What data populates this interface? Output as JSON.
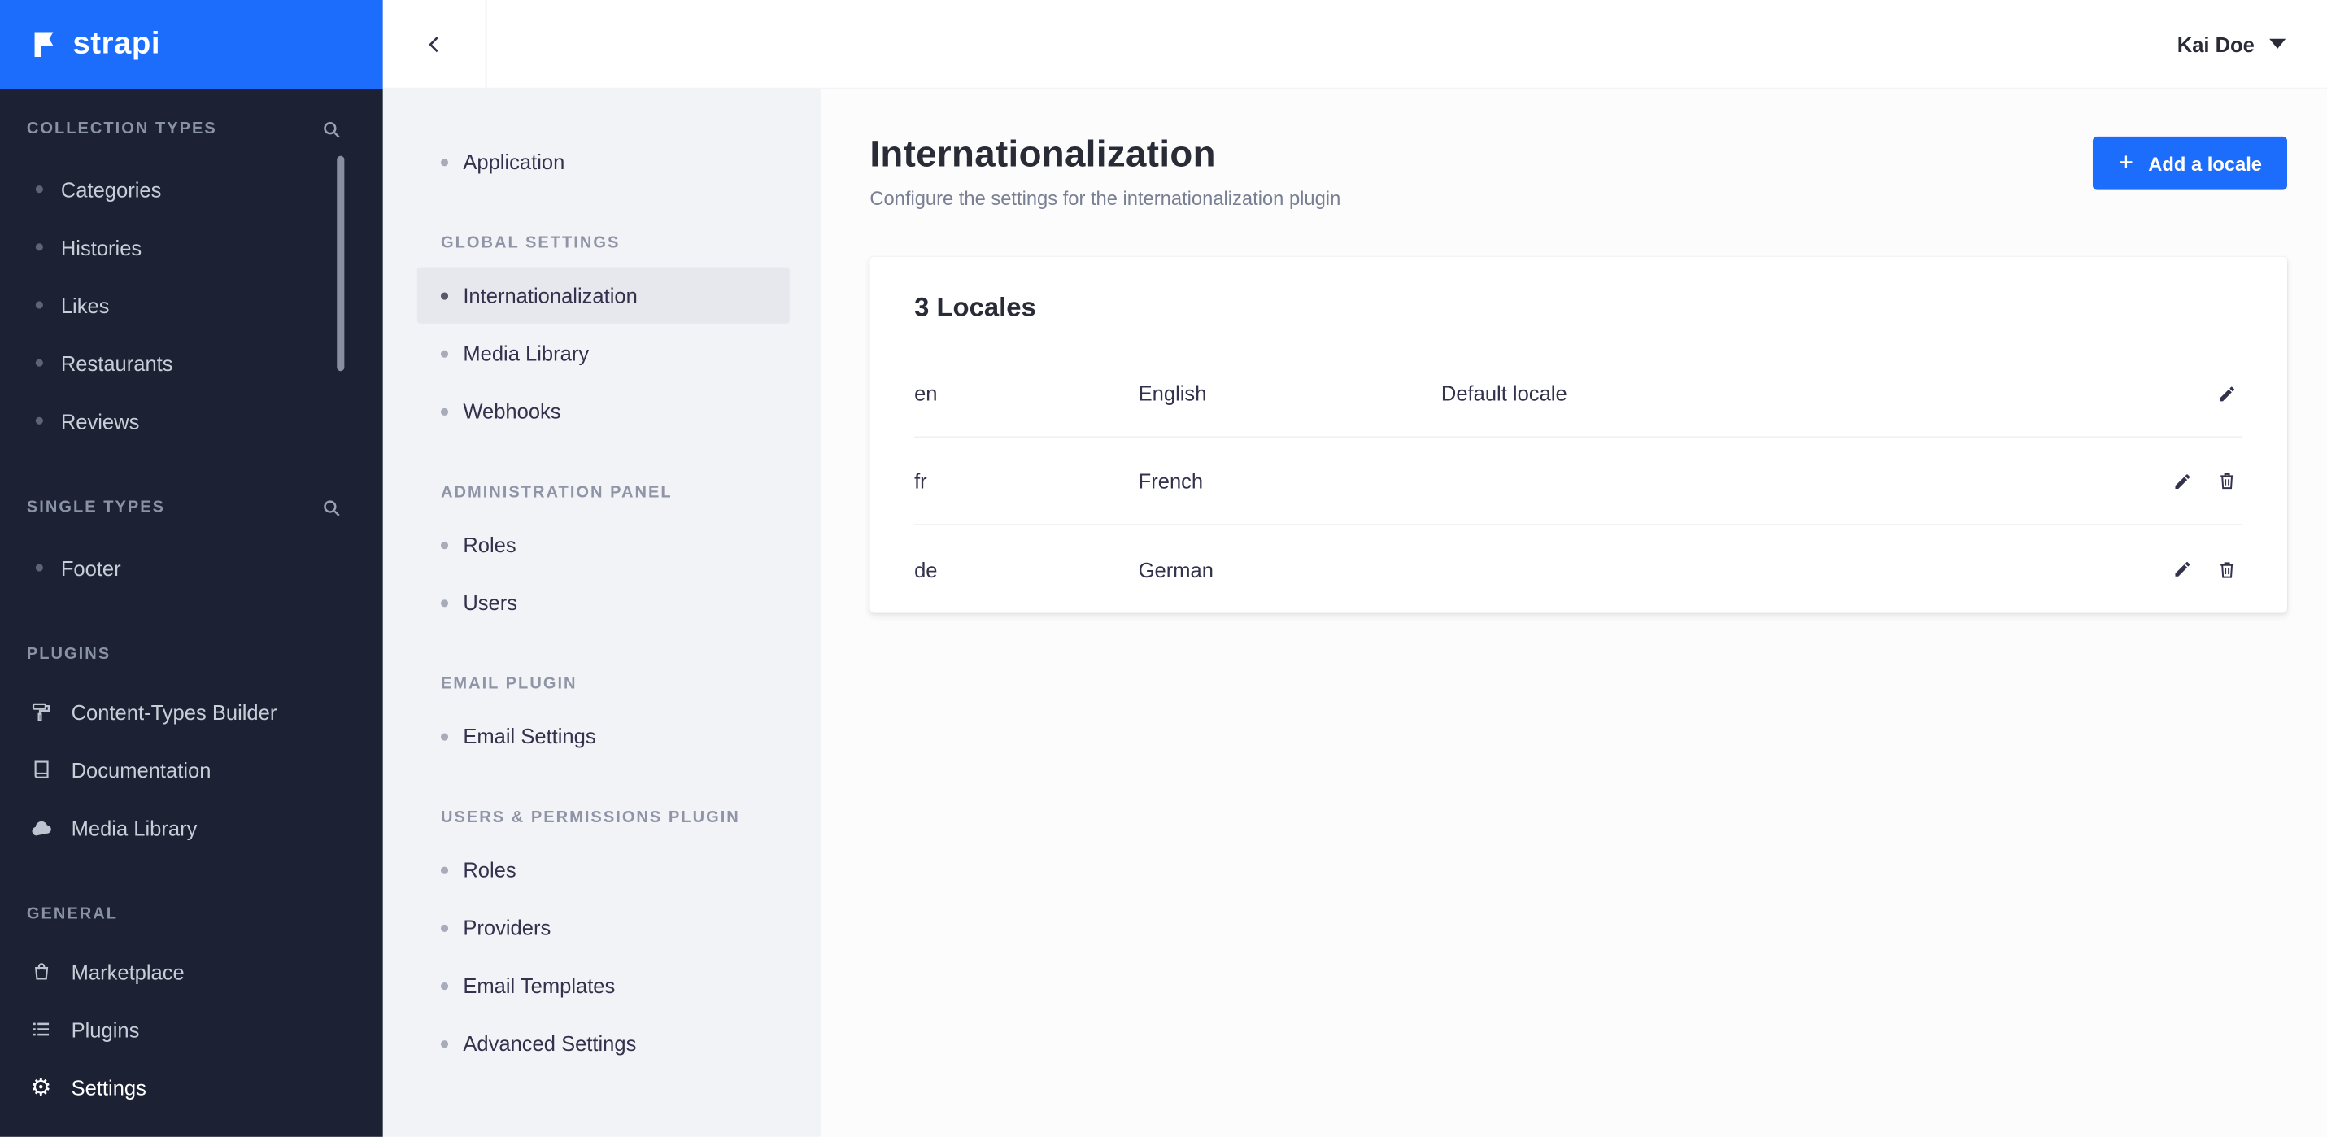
{
  "brand": {
    "logo_text": "strapi"
  },
  "topbar": {
    "user_name": "Kai Doe"
  },
  "colors": {
    "accent_blue": "#1c6dfb",
    "sidebar_bg": "#1c2233",
    "subnav_bg": "#f2f3f7"
  },
  "sidebar": {
    "collection_types": {
      "heading": "COLLECTION TYPES",
      "items": [
        "Categories",
        "Histories",
        "Likes",
        "Restaurants",
        "Reviews"
      ]
    },
    "single_types": {
      "heading": "SINGLE TYPES",
      "items": [
        "Footer"
      ]
    },
    "plugins": {
      "heading": "PLUGINS",
      "items": [
        "Content-Types Builder",
        "Documentation",
        "Media Library"
      ]
    },
    "general": {
      "heading": "GENERAL",
      "items": [
        "Marketplace",
        "Plugins",
        "Settings"
      ]
    }
  },
  "settings_nav": {
    "application": "Application",
    "global_settings": {
      "heading": "GLOBAL SETTINGS",
      "items": [
        "Internationalization",
        "Media Library",
        "Webhooks"
      ]
    },
    "administration_panel": {
      "heading": "ADMINISTRATION PANEL",
      "items": [
        "Roles",
        "Users"
      ]
    },
    "email_plugin": {
      "heading": "EMAIL PLUGIN",
      "items": [
        "Email Settings"
      ]
    },
    "users_permissions": {
      "heading": "USERS & PERMISSIONS PLUGIN",
      "items": [
        "Roles",
        "Providers",
        "Email Templates",
        "Advanced Settings"
      ]
    }
  },
  "main": {
    "title": "Internationalization",
    "subtitle": "Configure the settings for the internationalization plugin",
    "add_locale_button": "Add a locale",
    "locales_card": {
      "title": "3 Locales",
      "rows": [
        {
          "code": "en",
          "name": "English",
          "note": "Default locale"
        },
        {
          "code": "fr",
          "name": "French",
          "note": ""
        },
        {
          "code": "de",
          "name": "German",
          "note": ""
        }
      ]
    }
  }
}
